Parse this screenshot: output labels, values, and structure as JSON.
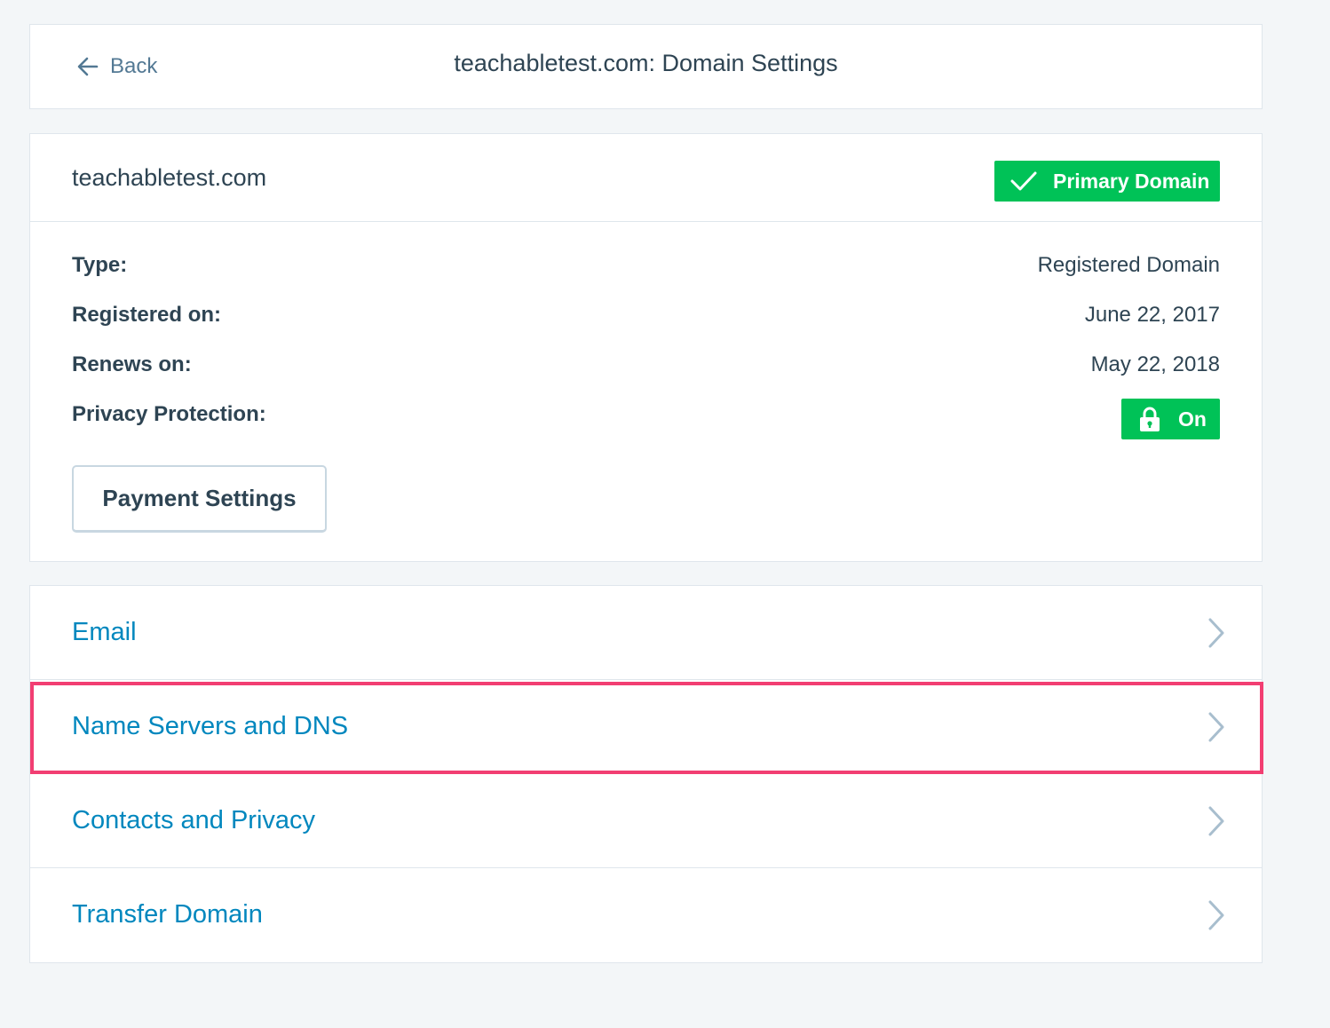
{
  "header": {
    "back_label": "Back",
    "title": "teachabletest.com: Domain Settings"
  },
  "domain": {
    "name": "teachabletest.com",
    "primary_badge": "Primary Domain",
    "details": [
      {
        "label": "Type:",
        "value": "Registered Domain"
      },
      {
        "label": "Registered on:",
        "value": "June 22, 2017"
      },
      {
        "label": "Renews on:",
        "value": "May 22, 2018"
      },
      {
        "label": "Privacy Protection:",
        "value": "On"
      }
    ],
    "payment_button": "Payment Settings"
  },
  "nav": {
    "items": [
      {
        "label": "Email"
      },
      {
        "label": "Name Servers and DNS",
        "highlighted": true
      },
      {
        "label": "Contacts and Privacy"
      },
      {
        "label": "Transfer Domain"
      }
    ]
  },
  "icons": {
    "back": "arrow-left-icon",
    "primary": "checkmark-icon",
    "privacy": "lock-icon",
    "nav": "chevron-right-icon"
  },
  "colors": {
    "accent": "#0087be",
    "success": "#00c257",
    "highlight": "#f23e72",
    "text": "#2e4453",
    "background": "#f3f6f8"
  }
}
